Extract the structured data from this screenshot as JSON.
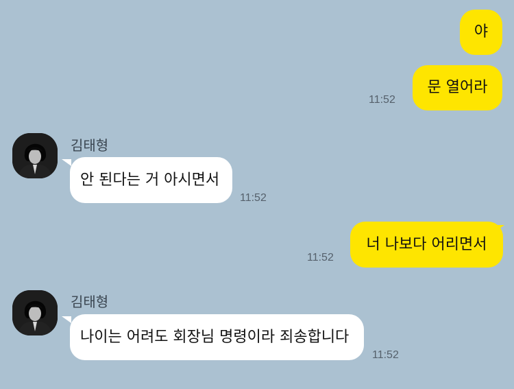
{
  "chat": {
    "contact_name": "김태형",
    "messages": [
      {
        "sender": "me",
        "text": "야"
      },
      {
        "sender": "me",
        "text": "문 열어라",
        "time": "11:52"
      },
      {
        "sender": "other",
        "name": "김태형",
        "text": "안 된다는 거 아시면서",
        "time": "11:52"
      },
      {
        "sender": "me",
        "text": "너 나보다 어리면서",
        "time": "11:52"
      },
      {
        "sender": "other",
        "name": "김태형",
        "text": "나이는 어려도 회장님 명령이라 죄송합니다",
        "time": "11:52"
      }
    ]
  },
  "colors": {
    "background": "#abc1d1",
    "my_bubble": "#fee500",
    "other_bubble": "#ffffff"
  },
  "icons": {
    "avatar": "profile-photo"
  }
}
